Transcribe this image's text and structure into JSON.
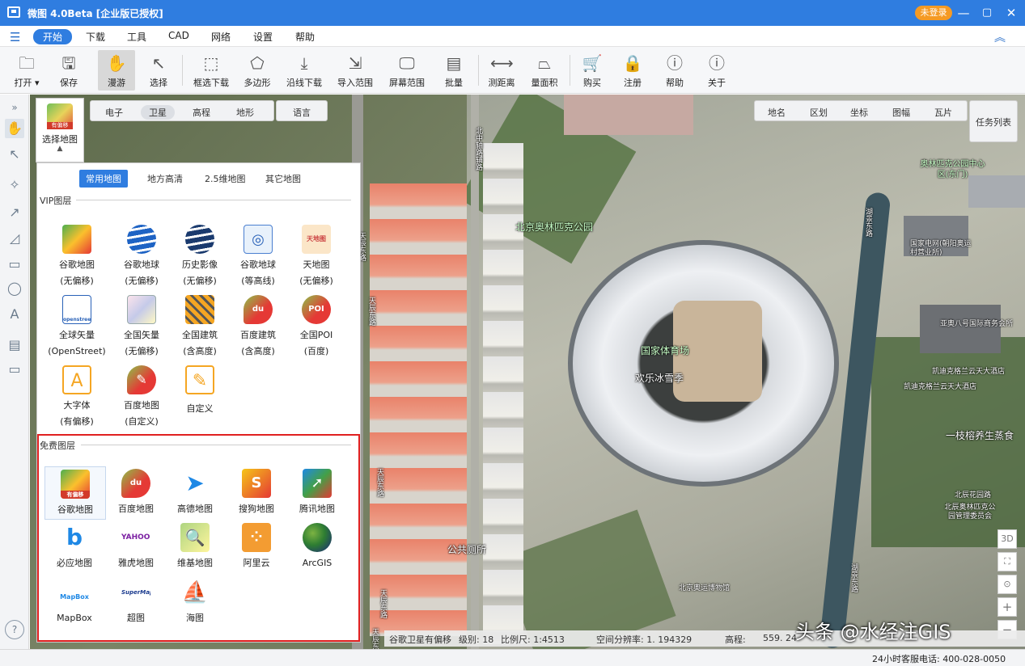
{
  "window": {
    "title": "微图 4.0Beta [企业版已授权]",
    "login_badge": "未登录",
    "minimize": "—",
    "maximize": "▢",
    "close": "✕"
  },
  "menu": {
    "items": [
      "开始",
      "下载",
      "工具",
      "CAD",
      "网络",
      "设置",
      "帮助"
    ],
    "active": "开始",
    "collapse_icon": "chevron-up-icon"
  },
  "toolbar": {
    "items": [
      {
        "label": "打开 ▾",
        "icon": "folder-icon"
      },
      {
        "label": "保存",
        "icon": "save-icon"
      },
      {
        "label": "漫游",
        "icon": "hand-icon"
      },
      {
        "label": "选择",
        "icon": "pointer-icon"
      },
      {
        "label": "框选下载",
        "icon": "box-download-icon"
      },
      {
        "label": "多边形",
        "icon": "polygon-icon"
      },
      {
        "label": "沿线下载",
        "icon": "line-download-icon"
      },
      {
        "label": "导入范围",
        "icon": "import-icon"
      },
      {
        "label": "屏幕范围",
        "icon": "screen-icon"
      },
      {
        "label": "批量",
        "icon": "batch-icon"
      },
      {
        "label": "测距离",
        "icon": "ruler-icon"
      },
      {
        "label": "量面积",
        "icon": "area-icon"
      },
      {
        "label": "购买",
        "icon": "cart-icon"
      },
      {
        "label": "注册",
        "icon": "lock-icon"
      },
      {
        "label": "帮助",
        "icon": "question-icon"
      },
      {
        "label": "关于",
        "icon": "info-icon"
      }
    ]
  },
  "map_type_bar": {
    "items": [
      "电子",
      "卫星",
      "高程",
      "地形"
    ],
    "selected": "卫星",
    "language": "语言"
  },
  "overlay_bar": {
    "items": [
      "地名",
      "区划",
      "坐标",
      "图幅",
      "瓦片"
    ],
    "task_list": "任务列表"
  },
  "select_map": {
    "badge": "有偏移",
    "label": "选择地图"
  },
  "layer_panel": {
    "tabs": [
      "常用地图",
      "地方高清",
      "2.5维地图",
      "其它地图"
    ],
    "selected_tab": "常用地图",
    "vip_title": "VIP图层",
    "vip_layers": [
      {
        "name": "谷歌地图",
        "sub": "(无偏移)",
        "icon": "google-maps-icon"
      },
      {
        "name": "谷歌地球",
        "sub": "(无偏移)",
        "icon": "google-earth-icon"
      },
      {
        "name": "历史影像",
        "sub": "(无偏移)",
        "icon": "history-imagery-icon"
      },
      {
        "name": "谷歌地球",
        "sub": "(等高线)",
        "icon": "contour-icon"
      },
      {
        "name": "天地图",
        "sub": "(无偏移)",
        "icon": "tianditu-icon",
        "badge": "天地图"
      },
      {
        "name": "全球矢量",
        "sub": "(OpenStreet)",
        "icon": "openstreet-icon",
        "badge": "openstreet"
      },
      {
        "name": "全国矢量",
        "sub": "(无偏移)",
        "icon": "china-vector-icon"
      },
      {
        "name": "全国建筑",
        "sub": "(含高度)",
        "icon": "building-icon"
      },
      {
        "name": "百度建筑",
        "sub": "(含高度)",
        "icon": "baidu-building-icon",
        "badge": "du"
      },
      {
        "name": "全国POI",
        "sub": "(百度)",
        "icon": "poi-icon",
        "badge": "POI"
      },
      {
        "name": "大字体",
        "sub": "(有偏移)",
        "icon": "big-font-icon",
        "badge": "A"
      },
      {
        "name": "百度地图",
        "sub": "(自定义)",
        "icon": "baidu-custom-icon"
      },
      {
        "name": "自定义",
        "sub": "",
        "icon": "custom-edit-icon"
      }
    ],
    "free_title": "免费图层",
    "free_layers": [
      {
        "name": "谷歌地图",
        "icon": "google-maps-icon",
        "badge": "有偏移"
      },
      {
        "name": "百度地图",
        "icon": "baidu-map-icon",
        "badge": "du"
      },
      {
        "name": "高德地图",
        "icon": "amap-icon"
      },
      {
        "name": "搜狗地图",
        "icon": "sogou-map-icon",
        "badge": "S"
      },
      {
        "name": "腾讯地图",
        "icon": "tencent-map-icon"
      },
      {
        "name": "必应地图",
        "icon": "bing-map-icon",
        "badge": "b"
      },
      {
        "name": "雅虎地图",
        "icon": "yahoo-map-icon",
        "badge": "YAHOO!"
      },
      {
        "name": "维基地图",
        "icon": "wiki-map-icon"
      },
      {
        "name": "阿里云",
        "icon": "aliyun-icon"
      },
      {
        "name": "ArcGIS",
        "icon": "arcgis-globe-icon"
      },
      {
        "name": "MapBox",
        "icon": "mapbox-icon",
        "badge": "MapBox"
      },
      {
        "name": "超图",
        "icon": "supermap-icon",
        "badge": "SuperMap"
      },
      {
        "name": "海图",
        "icon": "sea-chart-icon"
      }
    ]
  },
  "map_labels": [
    "北京奥林匹克公园",
    "国家体育场",
    "欢乐冰雪季",
    "公共厕所",
    "奥林匹克公园中心区(东门)",
    "国家电网(朝阳奥运村营业所)",
    "亚奥八号国际商务会所",
    "凯迪克格兰云天大酒店",
    "凯迪克格兰云天大酒店",
    "一枝榕养生蒸食",
    "北辰花园路",
    "北辰奥林匹克公园管理委员会",
    "北京奥运博物馆",
    "北中轴路辅路",
    "湖景东路",
    "天辰东路",
    "天辰东路",
    "天辰东路",
    "天辰东路",
    "湖景东路",
    "天辰东路"
  ],
  "right_controls": [
    "3D",
    "⛶",
    "⊙",
    "+",
    "−"
  ],
  "status": {
    "source": "谷歌卫星有偏移",
    "level": "级别: 18",
    "scale": "比例尺: 1:4513",
    "resolution": "空间分辨率: 1. 194329",
    "elevation_label": "高程:",
    "elevation_value": "559. 24"
  },
  "hotline": "24小时客服电话: 400-028-0050",
  "watermark": "头条 @水经注GIS",
  "left_tools": [
    "»",
    "✋",
    "↖",
    "✧",
    "↗",
    "◿",
    "▭",
    "◯",
    "A",
    "▤",
    "▭",
    "?"
  ]
}
